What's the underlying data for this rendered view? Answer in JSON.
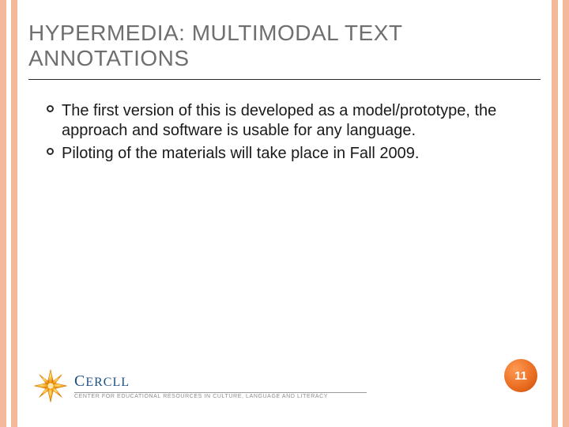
{
  "title": "HYPERMEDIA: MULTIMODAL TEXT ANNOTATIONS",
  "bullets": [
    "The first version of this is developed as a model/prototype, the approach and software is usable for any language.",
    "Piloting of the materials will take place in Fall 2009."
  ],
  "logo": {
    "name": "CERCLL",
    "tagline": "CENTER FOR EDUCATIONAL RESOURCES IN CULTURE, LANGUAGE AND LITERACY"
  },
  "pageNumber": "11",
  "colors": {
    "stripe": "#f4b89b",
    "titleText": "#6f6f6f",
    "badgeStart": "#ff9a52",
    "badgeEnd": "#c44f0a",
    "brandBlue": "#1d4f87"
  }
}
